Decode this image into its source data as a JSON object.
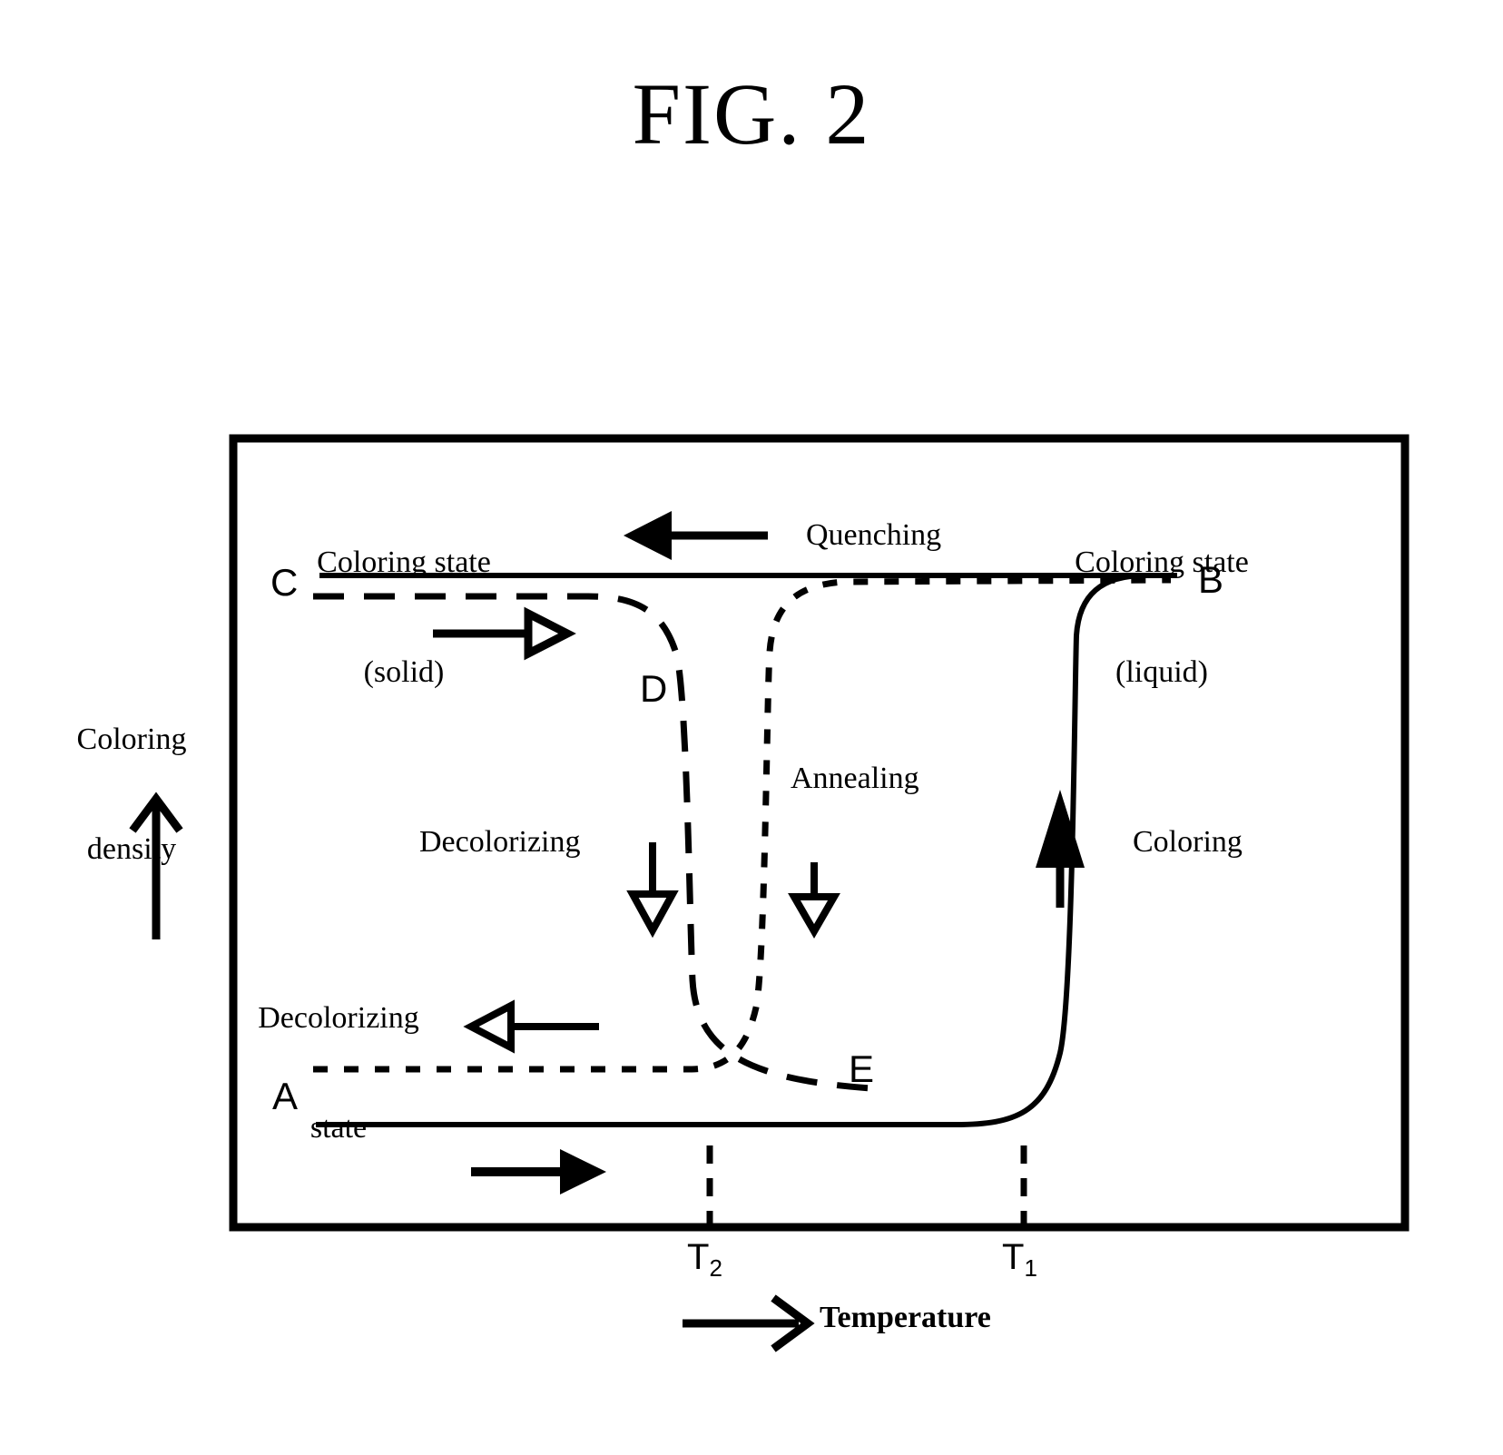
{
  "figure": {
    "title": "FIG. 2"
  },
  "axes": {
    "y_label_line1": "Coloring",
    "y_label_line2": "density",
    "y_arrow_icon": "up-arrow-icon",
    "x_label": "Temperature",
    "x_arrow_icon": "right-arrow-icon",
    "x_ticks": [
      {
        "id": "t2",
        "label_base": "T",
        "label_sub": "2"
      },
      {
        "id": "t1",
        "label_base": "T",
        "label_sub": "1"
      }
    ]
  },
  "regions": {
    "coloring_solid_line1": "Coloring state",
    "coloring_solid_line2": "(solid)",
    "coloring_liquid_line1": "Coloring state",
    "coloring_liquid_line2": "(liquid)",
    "decolorizing_state_line1": "Decolorizing",
    "decolorizing_state_line2": "state"
  },
  "process_labels": {
    "quenching": "Quenching",
    "annealing": "Annealing",
    "decolorizing": "Decolorizing",
    "coloring": "Coloring"
  },
  "points": [
    {
      "id": "A",
      "label": "A"
    },
    {
      "id": "B",
      "label": "B"
    },
    {
      "id": "C",
      "label": "C"
    },
    {
      "id": "D",
      "label": "D"
    },
    {
      "id": "E",
      "label": "E"
    }
  ],
  "colors": {
    "ink": "#000000",
    "background": "#ffffff"
  },
  "chart_data": {
    "type": "line",
    "title": "FIG. 2",
    "xlabel": "Temperature",
    "ylabel": "Coloring density",
    "grid": false,
    "legend": "none",
    "xlim": [
      0,
      100
    ],
    "ylim": [
      0,
      100
    ],
    "xticks": [
      {
        "label": "T2",
        "x": 41
      },
      {
        "label": "T1",
        "x": 68
      }
    ],
    "annotations": [
      {
        "text": "Coloring state (solid)",
        "x": 15,
        "y": 92
      },
      {
        "text": "Coloring state (liquid)",
        "x": 86,
        "y": 92
      },
      {
        "text": "Quenching",
        "x": 52,
        "y": 88
      },
      {
        "text": "Annealing",
        "x": 55,
        "y": 56
      },
      {
        "text": "Decolorizing",
        "x": 30,
        "y": 49
      },
      {
        "text": "Coloring",
        "x": 82,
        "y": 49
      },
      {
        "text": "Decolorizing state",
        "x": 11,
        "y": 27
      },
      {
        "text": "A",
        "x": 5,
        "y": 8
      },
      {
        "text": "B",
        "x": 97,
        "y": 81
      },
      {
        "text": "C",
        "x": 4,
        "y": 81
      },
      {
        "text": "D",
        "x": 38,
        "y": 67
      },
      {
        "text": "E",
        "x": 56,
        "y": 12
      }
    ],
    "series": [
      {
        "name": "Quenching (coloring state, solid) — top plateau C to B",
        "style": "solid",
        "x": [
          4,
          20,
          40,
          60,
          80,
          97
        ],
        "y": [
          81,
          81,
          81,
          81,
          81,
          81
        ]
      },
      {
        "name": "Coloring (heating to liquid) — bottom plateau A rising at T1 to B",
        "style": "solid",
        "x": [
          4,
          20,
          40,
          55,
          64,
          68,
          70,
          72,
          78,
          90,
          97
        ],
        "y": [
          5,
          5,
          5,
          5,
          6,
          12,
          40,
          68,
          79,
          81,
          81
        ],
        "comment": "sharp rise at T1"
      },
      {
        "name": "Decolorizing (dashed) — from C falling at T2 to E",
        "style": "dashed",
        "x": [
          4,
          18,
          30,
          36,
          39,
          41,
          42,
          43,
          45,
          52,
          60
        ],
        "y": [
          78,
          78,
          78,
          76,
          70,
          55,
          35,
          20,
          12,
          10,
          10
        ]
      },
      {
        "name": "Annealing (dotted) — from E rising at T2 to B plateau",
        "style": "dotted",
        "x": [
          4,
          20,
          36,
          44,
          46,
          47,
          48,
          50,
          55,
          70,
          90
        ],
        "y": [
          11,
          11,
          11,
          12,
          20,
          40,
          62,
          75,
          80,
          80,
          80
        ]
      }
    ]
  }
}
